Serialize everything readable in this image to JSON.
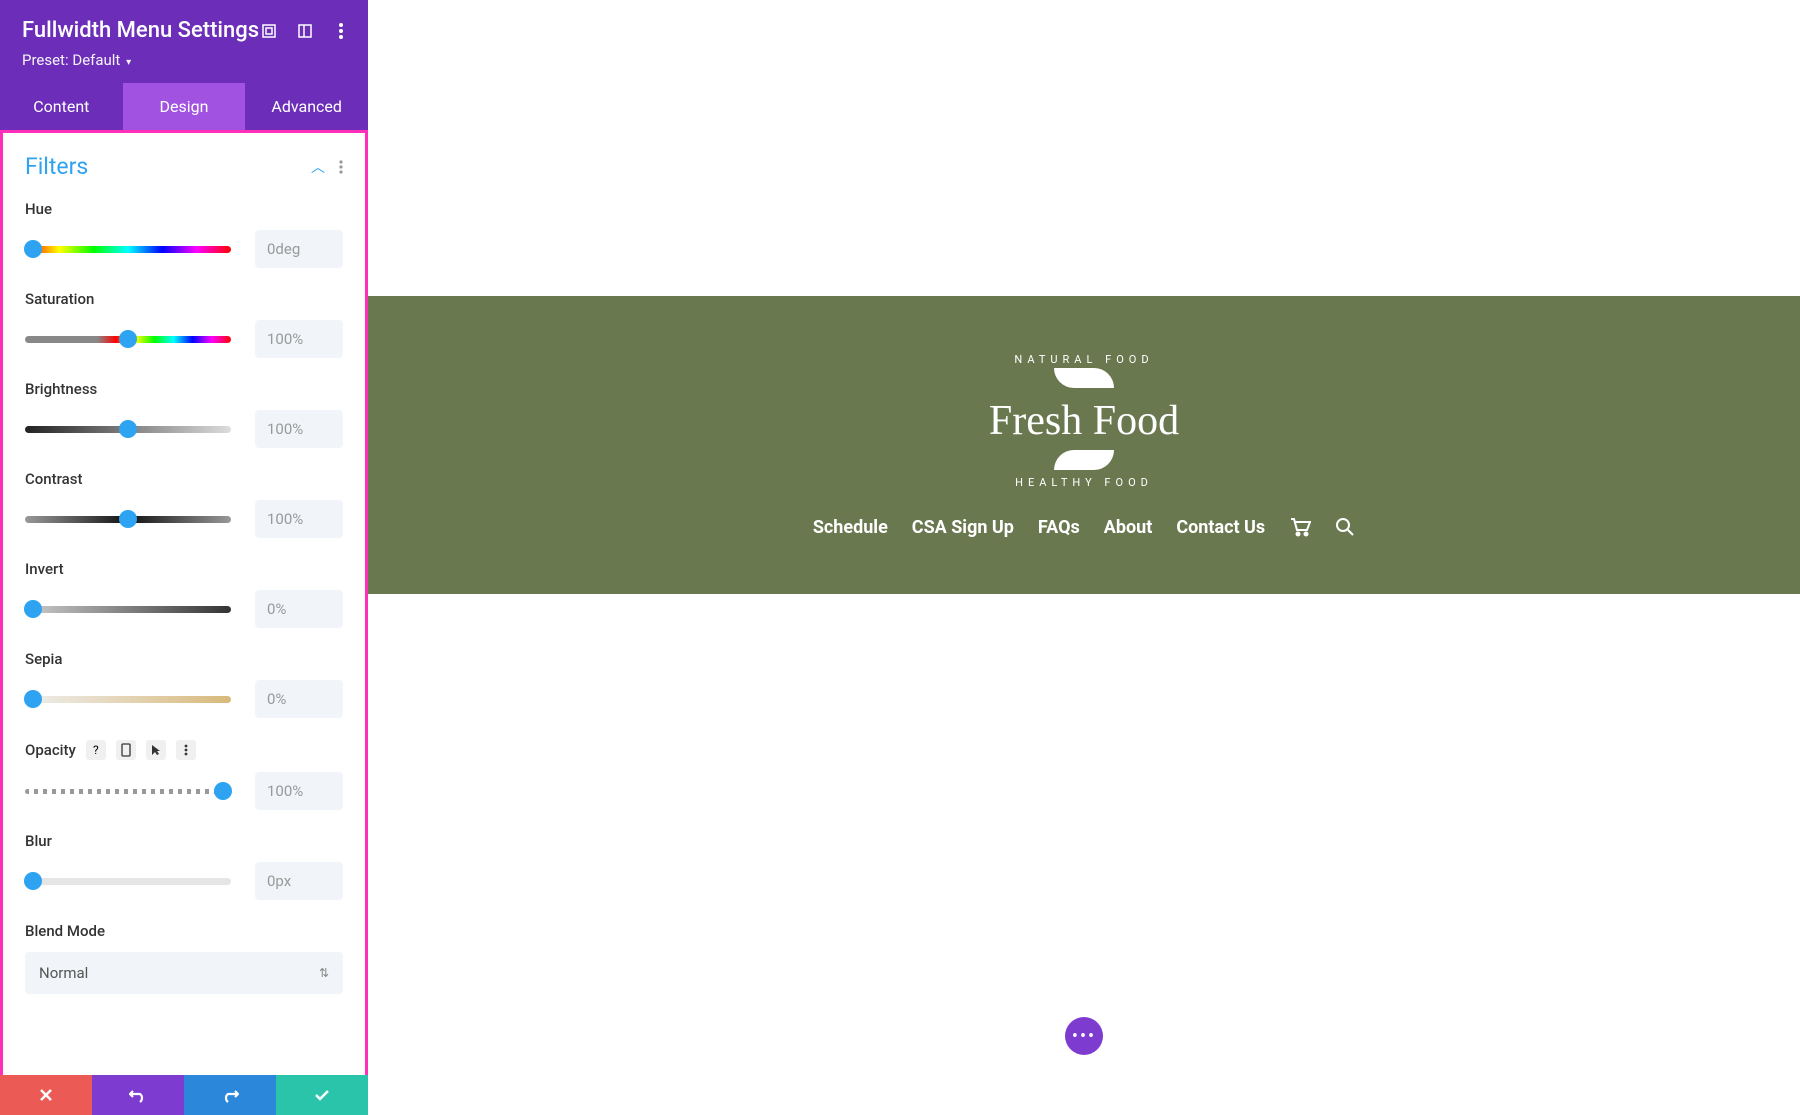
{
  "panel": {
    "title": "Fullwidth Menu Settings",
    "preset_label": "Preset:",
    "preset_value": "Default"
  },
  "tabs": {
    "content": "Content",
    "design": "Design",
    "advanced": "Advanced"
  },
  "section": {
    "title": "Filters"
  },
  "filters": {
    "hue": {
      "label": "Hue",
      "value": "0deg",
      "pos": 0
    },
    "saturation": {
      "label": "Saturation",
      "value": "100%",
      "pos": 50
    },
    "brightness": {
      "label": "Brightness",
      "value": "100%",
      "pos": 50
    },
    "contrast": {
      "label": "Contrast",
      "value": "100%",
      "pos": 50
    },
    "invert": {
      "label": "Invert",
      "value": "0%",
      "pos": 0
    },
    "sepia": {
      "label": "Sepia",
      "value": "0%",
      "pos": 0
    },
    "opacity": {
      "label": "Opacity",
      "value": "100%",
      "pos": 100
    },
    "blur": {
      "label": "Blur",
      "value": "0px",
      "pos": 0
    },
    "blend": {
      "label": "Blend Mode",
      "value": "Normal"
    }
  },
  "preview": {
    "logo_top": "NATURAL FOOD",
    "logo_main": "Fresh Food",
    "logo_bot": "HEALTHY FOOD",
    "nav": [
      "Schedule",
      "CSA Sign Up",
      "FAQs",
      "About",
      "Contact Us"
    ]
  }
}
